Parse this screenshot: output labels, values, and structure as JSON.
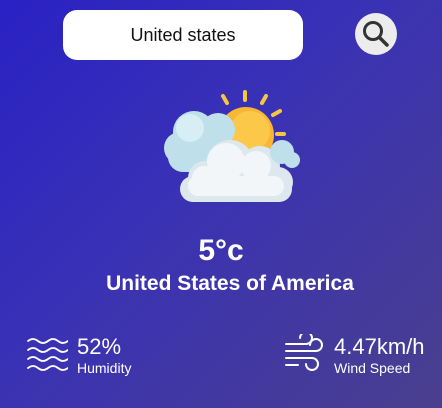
{
  "search": {
    "value": "United states",
    "button_icon": "search-icon"
  },
  "weather": {
    "icon": "partly-cloudy-icon",
    "temperature": "5°c",
    "city": "United States of America"
  },
  "details": {
    "humidity": {
      "icon": "humidity-waves-icon",
      "value": "52%",
      "label": "Humidity"
    },
    "wind": {
      "icon": "wind-icon",
      "value": "4.47km/h",
      "label": "Wind Speed"
    }
  },
  "colors": {
    "gradient_start": "#2a21c4",
    "gradient_end": "#4a3f8e",
    "sun": "#f7b733",
    "cloud": "#eef3f6"
  }
}
